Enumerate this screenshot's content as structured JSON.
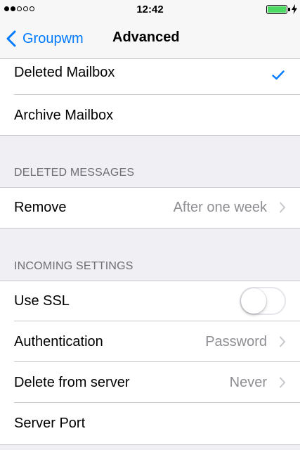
{
  "status_bar": {
    "time": "12:42",
    "signal_bars_filled": 2,
    "signal_bars_total": 5,
    "battery_color": "#4cd964"
  },
  "nav": {
    "back_label": "Groupwm",
    "title": "Advanced",
    "accent_color": "#007aff"
  },
  "mailbox_group": {
    "items": [
      {
        "label": "Deleted Mailbox",
        "checked": true
      },
      {
        "label": "Archive Mailbox",
        "checked": false
      }
    ]
  },
  "deleted_messages": {
    "header": "DELETED MESSAGES",
    "remove": {
      "label": "Remove",
      "value": "After one week"
    }
  },
  "incoming_settings": {
    "header": "INCOMING SETTINGS",
    "use_ssl": {
      "label": "Use SSL",
      "on": false
    },
    "authentication": {
      "label": "Authentication",
      "value": "Password"
    },
    "delete_from_server": {
      "label": "Delete from server",
      "value": "Never"
    },
    "server_port": {
      "label": "Server Port"
    }
  }
}
